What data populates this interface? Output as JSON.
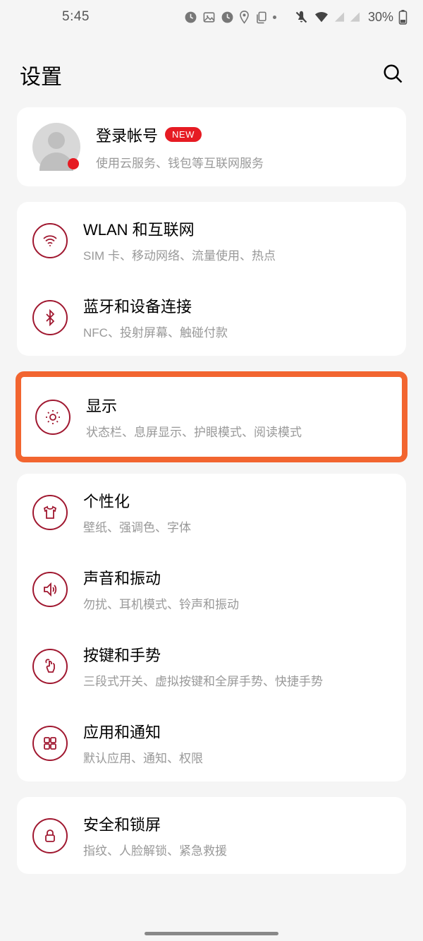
{
  "status_bar": {
    "time": "5:45",
    "battery": "30%"
  },
  "header": {
    "title": "设置"
  },
  "account": {
    "title": "登录帐号",
    "badge": "NEW",
    "subtitle": "使用云服务、钱包等互联网服务"
  },
  "group1": [
    {
      "title": "WLAN 和互联网",
      "subtitle": "SIM 卡、移动网络、流量使用、热点"
    },
    {
      "title": "蓝牙和设备连接",
      "subtitle": "NFC、投射屏幕、触碰付款"
    }
  ],
  "highlighted": {
    "title": "显示",
    "subtitle": "状态栏、息屏显示、护眼模式、阅读模式"
  },
  "group2": [
    {
      "title": "个性化",
      "subtitle": "壁纸、强调色、字体"
    },
    {
      "title": "声音和振动",
      "subtitle": "勿扰、耳机模式、铃声和振动"
    },
    {
      "title": "按键和手势",
      "subtitle": "三段式开关、虚拟按键和全屏手势、快捷手势"
    },
    {
      "title": "应用和通知",
      "subtitle": "默认应用、通知、权限"
    }
  ],
  "group3": [
    {
      "title": "安全和锁屏",
      "subtitle": "指纹、人脸解锁、紧急救援"
    }
  ]
}
